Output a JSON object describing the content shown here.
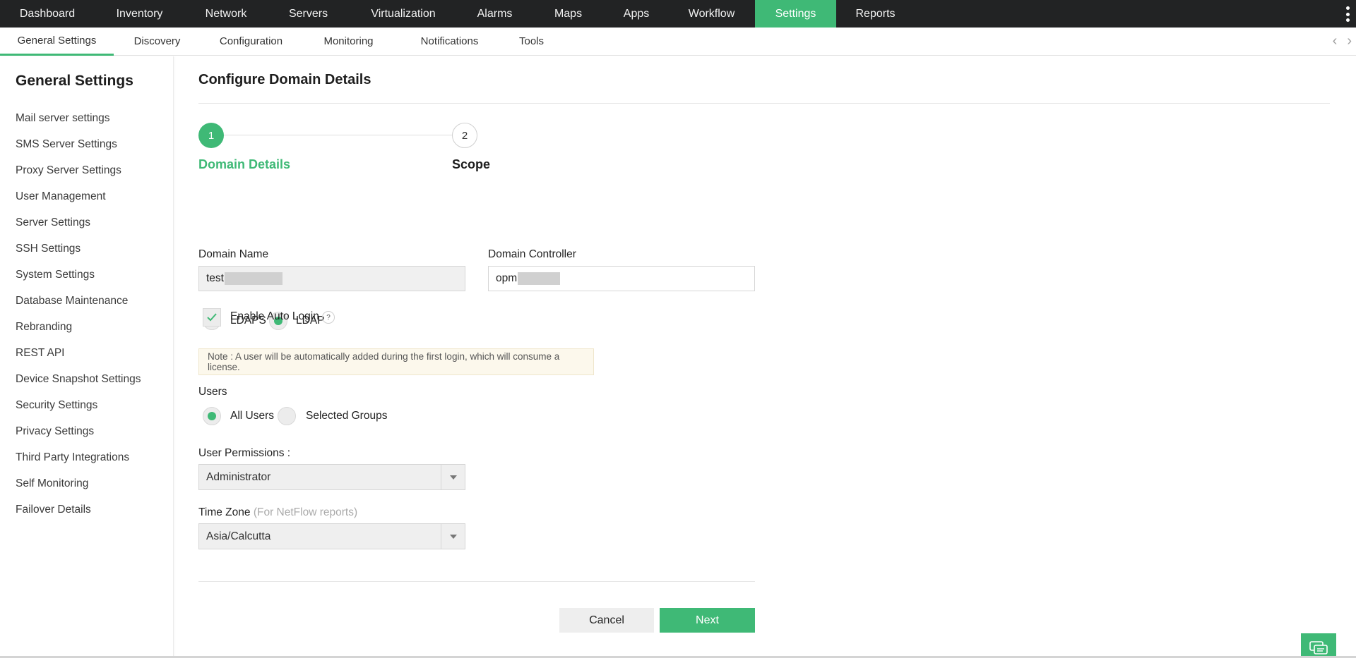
{
  "topnav": {
    "tabs": [
      {
        "label": "Dashboard"
      },
      {
        "label": "Inventory"
      },
      {
        "label": "Network"
      },
      {
        "label": "Servers"
      },
      {
        "label": "Virtualization"
      },
      {
        "label": "Alarms"
      },
      {
        "label": "Maps"
      },
      {
        "label": "Apps"
      },
      {
        "label": "Workflow"
      },
      {
        "label": "Settings",
        "active": true
      },
      {
        "label": "Reports"
      }
    ]
  },
  "subnav": {
    "tabs": [
      {
        "label": "General Settings",
        "active": true
      },
      {
        "label": "Discovery"
      },
      {
        "label": "Configuration"
      },
      {
        "label": "Monitoring"
      },
      {
        "label": "Notifications"
      },
      {
        "label": "Tools"
      }
    ],
    "prev_icon": "‹",
    "next_icon": "›"
  },
  "sidebar": {
    "title": "General Settings",
    "items": [
      {
        "label": "Mail server settings"
      },
      {
        "label": "SMS Server Settings"
      },
      {
        "label": "Proxy Server Settings"
      },
      {
        "label": "User Management"
      },
      {
        "label": "Server Settings"
      },
      {
        "label": "SSH Settings"
      },
      {
        "label": "System Settings"
      },
      {
        "label": "Database Maintenance"
      },
      {
        "label": "Rebranding"
      },
      {
        "label": "REST API"
      },
      {
        "label": "Device Snapshot Settings"
      },
      {
        "label": "Security Settings"
      },
      {
        "label": "Privacy Settings"
      },
      {
        "label": "Third Party Integrations"
      },
      {
        "label": "Self Monitoring"
      },
      {
        "label": "Failover Details"
      }
    ]
  },
  "main": {
    "title": "Configure Domain Details",
    "steps": [
      {
        "number": "1",
        "label": "Domain Details",
        "active": true
      },
      {
        "number": "2",
        "label": "Scope",
        "active": false
      }
    ],
    "domain_name": {
      "label": "Domain Name",
      "value": "test"
    },
    "domain_controller": {
      "label": "Domain Controller",
      "value": "opm"
    },
    "protocol": {
      "options": [
        {
          "label": "LDAPS",
          "selected": false
        },
        {
          "label": "LDAP",
          "selected": true
        }
      ]
    },
    "auto_login": {
      "label": "Enable Auto Login",
      "checked": true,
      "help": "?"
    },
    "note": "Note : A user will be automatically added during the first login, which will consume a license.",
    "users": {
      "label": "Users",
      "options": [
        {
          "label": "All Users",
          "selected": true
        },
        {
          "label": "Selected Groups",
          "selected": false
        }
      ]
    },
    "user_permissions": {
      "label": "User Permissions :",
      "value": "Administrator"
    },
    "time_zone": {
      "label": "Time Zone",
      "hint": "(For NetFlow reports)",
      "value": "Asia/Calcutta"
    },
    "buttons": {
      "cancel": "Cancel",
      "next": "Next"
    }
  },
  "colors": {
    "accent": "#3fb976",
    "topnav_bg": "#222324",
    "note_bg": "#fcf8ec"
  },
  "icons": {
    "menu": "kebab-icon",
    "chat": "chat-icon",
    "check": "check-icon"
  }
}
